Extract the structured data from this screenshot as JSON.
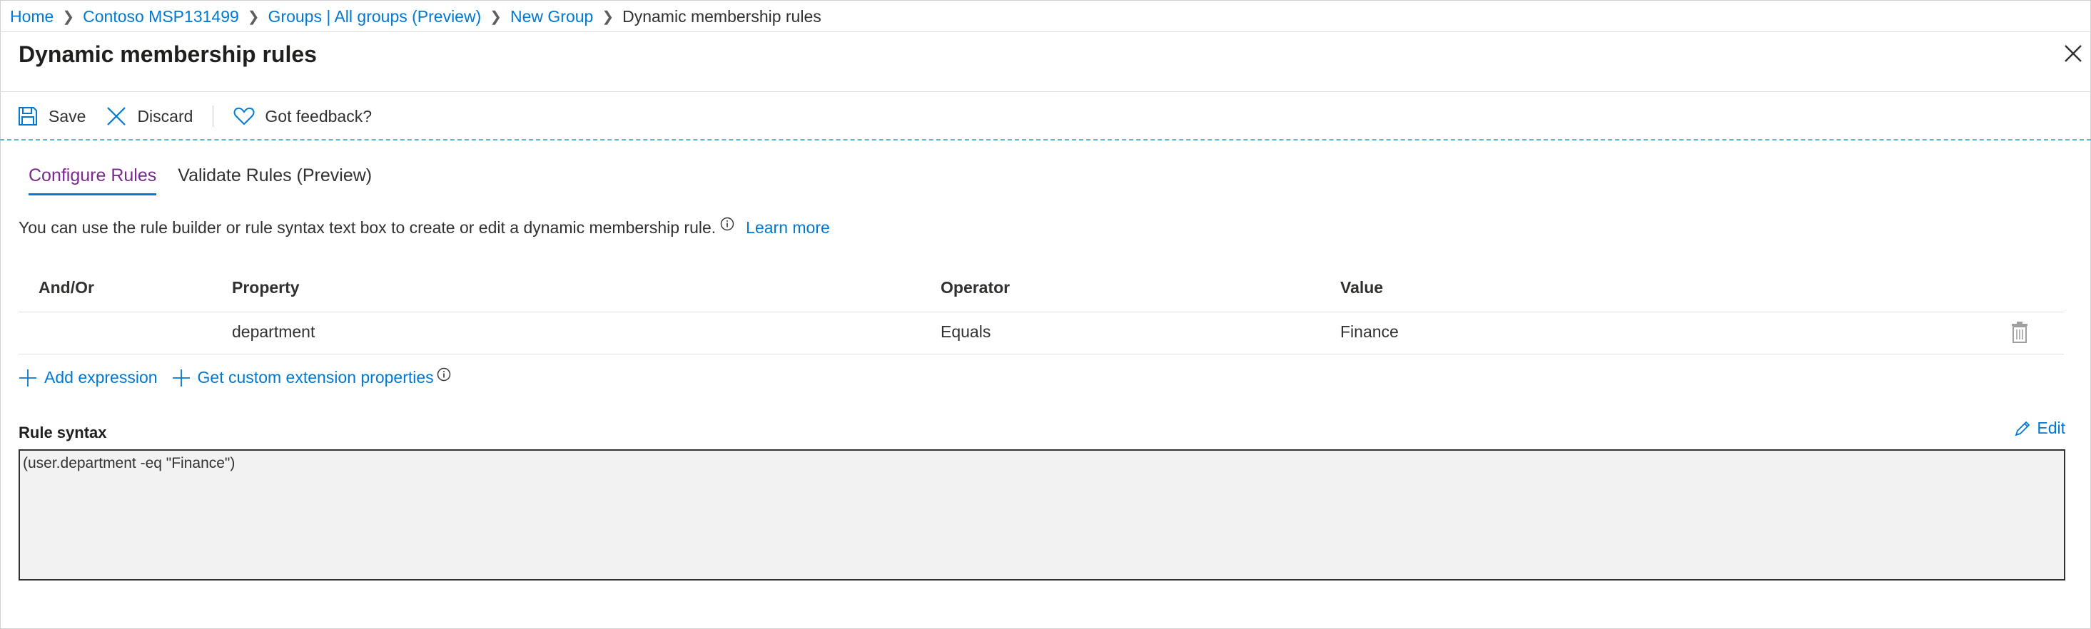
{
  "breadcrumb": {
    "items": [
      "Home",
      "Contoso MSP131499",
      "Groups | All groups (Preview)",
      "New Group"
    ],
    "current": "Dynamic membership rules"
  },
  "page": {
    "title": "Dynamic membership rules"
  },
  "toolbar": {
    "save": "Save",
    "discard": "Discard",
    "feedback": "Got feedback?"
  },
  "tabs": {
    "configure": "Configure Rules",
    "validate": "Validate Rules (Preview)",
    "active": "configure"
  },
  "description": {
    "text": "You can use the rule builder or rule syntax text box to create or edit a dynamic membership rule.",
    "learn_more": "Learn more"
  },
  "table": {
    "columns": [
      "And/Or",
      "Property",
      "Operator",
      "Value"
    ],
    "rows": [
      {
        "andor": "",
        "property": "department",
        "operator": "Equals",
        "value": "Finance"
      }
    ]
  },
  "actions": {
    "add_expression": "Add expression",
    "custom_ext": "Get custom extension properties"
  },
  "rule_syntax": {
    "label": "Rule syntax",
    "edit": "Edit",
    "value": "(user.department -eq \"Finance\")"
  },
  "icons": [
    "chevron-right-icon",
    "close-icon",
    "save-icon",
    "discard-icon",
    "heart-icon",
    "info-icon",
    "trash-icon",
    "plus-icon",
    "pencil-icon"
  ],
  "colors": {
    "link": "#0078d4",
    "active_tab": "#7a2a8c",
    "dashed_line": "#5cb8d4",
    "syntax_bg": "#f2f2f2"
  }
}
